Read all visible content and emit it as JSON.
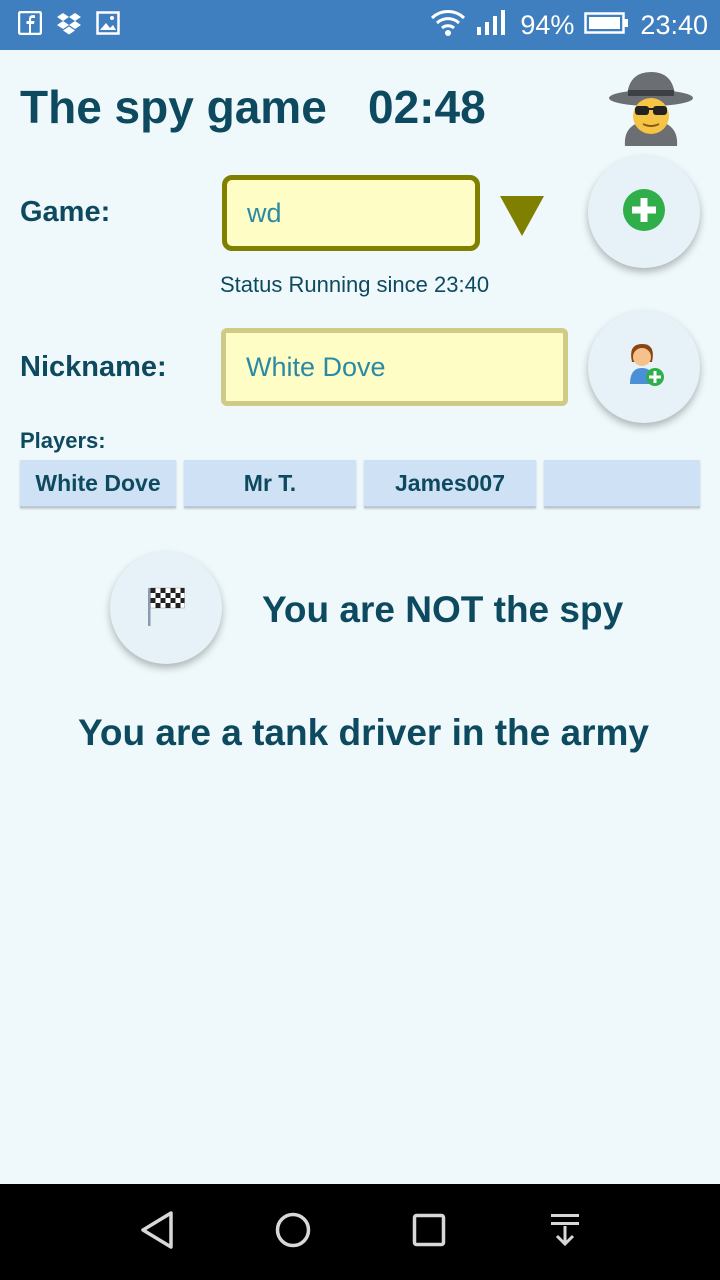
{
  "statusbar": {
    "battery_percent": "94%",
    "time": "23:40",
    "icons": [
      "facebook-icon",
      "dropbox-icon",
      "gallery-icon",
      "wifi-icon",
      "signal-icon",
      "battery-icon"
    ]
  },
  "header": {
    "title": "The spy game",
    "timer": "02:48",
    "spy_icon": "spy-icon"
  },
  "game": {
    "label": "Game:",
    "value": "wd",
    "dropdown_icon": "dropdown-triangle-icon",
    "add_icon": "add-game-icon",
    "status": "Status Running since 23:40"
  },
  "nickname": {
    "label": "Nickname:",
    "value": "White Dove",
    "add_icon": "add-player-icon"
  },
  "players": {
    "label": "Players:",
    "list": [
      "White Dove",
      "Mr T.",
      "James007",
      ""
    ]
  },
  "role": {
    "flag_icon": "checkered-flag-icon",
    "spy_status": "You are NOT the spy",
    "description": "You are a tank driver in the army"
  },
  "navbar": {
    "icons": [
      "back-icon",
      "home-icon",
      "recents-icon",
      "notifications-icon"
    ]
  },
  "colors": {
    "accent": "#0e4a5f",
    "statusbar": "#3f7fbf",
    "background": "#eff9fb",
    "field_fill": "#fffdc6",
    "chip": "#cfe2f5",
    "dropdown": "#7f7f00",
    "add_green": "#2fae4a"
  }
}
